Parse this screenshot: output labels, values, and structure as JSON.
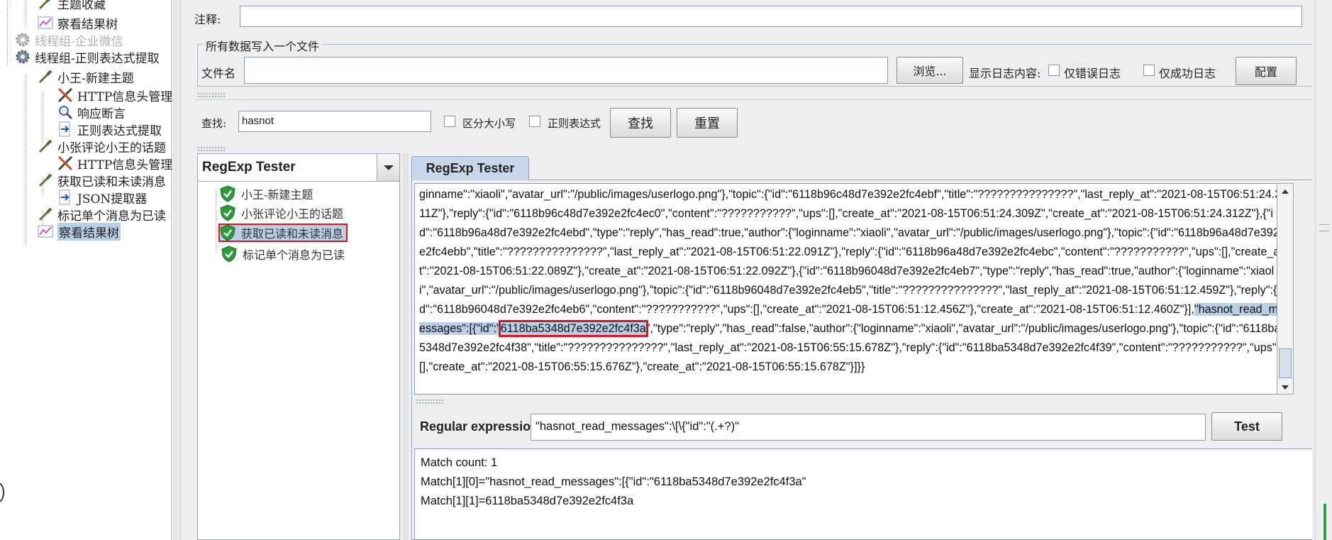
{
  "tree": {
    "items": [
      {
        "label": "主题收藏",
        "icon": "dropper-icon"
      },
      {
        "label": "察看结果树",
        "icon": "chart-icon"
      },
      {
        "label": "线程组-企业微信",
        "icon": "gear-icon"
      },
      {
        "label": "线程组-正则表达式提取",
        "icon": "gear-icon"
      },
      {
        "label": "小王-新建主题",
        "icon": "dropper-icon"
      },
      {
        "label": "HTTP信息头管理",
        "icon": "tools-icon"
      },
      {
        "label": "响应断言",
        "icon": "magnifier-icon"
      },
      {
        "label": "正则表达式提取",
        "icon": "arrow-doc-icon"
      },
      {
        "label": "小张评论小王的话题",
        "icon": "dropper-icon"
      },
      {
        "label": "HTTP信息头管理",
        "icon": "tools-icon"
      },
      {
        "label": "获取已读和未读消息",
        "icon": "dropper-icon"
      },
      {
        "label": "JSON提取器",
        "icon": "arrow-doc-icon"
      },
      {
        "label": "标记单个消息为已读",
        "icon": "dropper-icon"
      },
      {
        "label": "察看结果树",
        "icon": "chart-icon"
      }
    ]
  },
  "comment": {
    "label": "注释:",
    "value": ""
  },
  "file_section": {
    "legend": "所有数据写入一个文件",
    "filename_label": "文件名",
    "filename_value": "",
    "browse_label": "浏览...",
    "log_label": "显示日志内容:",
    "errors_only_label": "仅错误日志",
    "success_only_label": "仅成功日志",
    "config_label": "配置"
  },
  "search": {
    "label": "查找:",
    "value": "hasnot",
    "case_label": "区分大小写",
    "regex_label": "正则表达式",
    "find_label": "查找",
    "reset_label": "重置"
  },
  "renderer": {
    "selected": "RegExp Tester"
  },
  "results": [
    {
      "label": "小王-新建主题",
      "status": "success"
    },
    {
      "label": "小张评论小王的话题",
      "status": "success"
    },
    {
      "label": "获取已读和未读消息",
      "status": "success"
    },
    {
      "label": "标记单个消息为已读",
      "status": "success"
    }
  ],
  "tab_label": "RegExp Tester",
  "response": {
    "part1": "ginname\":\"xiaoli\",\"avatar_url\":\"/public/images/userlogo.png\"},\"topic\":{\"id\":\"6118b96c48d7e392e2fc4ebf\",\"title\":\"???????????????\",\"last_reply_at\":\"2021-08-15T06:51:24.311Z\"},\"reply\":{\"id\":\"6118b96c48d7e392e2fc4ec0\",\"content\":\"???????????\",\"ups\":[],\"create_at\":\"2021-08-15T06:51:24.309Z\",\"create_at\":\"2021-08-15T06:51:24.312Z\"},{\"id\":\"6118b96a48d7e392e2fc4ebd\",\"type\":\"reply\",\"has_read\":true,\"author\":{\"loginname\":\"xiaoli\",\"avatar_url\":\"/public/images/userlogo.png\"},\"topic\":{\"id\":\"6118b96a48d7e392e2fc4ebb\",\"title\":\"???????????????\",\"last_reply_at\":\"2021-08-15T06:51:22.091Z\"},\"reply\":{\"id\":\"6118b96a48d7e392e2fc4ebc\",\"content\":\"???????????\",\"ups\":[],\"create_at\":\"2021-08-15T06:51:22.089Z\"},\"create_at\":\"2021-08-15T06:51:22.092Z\"},{\"id\":\"6118b96048d7e392e2fc4eb7\",\"type\":\"reply\",\"has_read\":true,\"author\":{\"loginname\":\"xiaoli\",\"avatar_url\":\"/public/images/userlogo.png\"},\"topic\":{\"id\":\"6118b96048d7e392e2fc4eb5\",\"title\":\"???????????????\",\"last_reply_at\":\"2021-08-15T06:51:12.459Z\"},\"reply\":{\"id\":\"6118b96048d7e392e2fc4eb6\",\"content\":\"???????????\",\"ups\":[],\"create_at\":\"2021-08-15T06:51:12.456Z\"},\"create_at\":\"2021-08-15T06:51:12.460Z\"}],",
    "highlight": "\"hasnot_read_messages\":[{\"id\":\"",
    "match_id": "6118ba5348d7e392e2fc4f3a",
    "part2": "\",\"type\":\"reply\",\"has_read\":false,\"author\":{\"loginname\":\"xiaoli\",\"avatar_url\":\"/public/images/userlogo.png\"},\"topic\":{\"id\":\"6118ba5348d7e392e2fc4f38\",\"title\":\"???????????????\",\"last_reply_at\":\"2021-08-15T06:55:15.678Z\"},\"reply\":{\"id\":\"6118ba5348d7e392e2fc4f39\",\"content\":\"???????????\",\"ups\":[],\"create_at\":\"2021-08-15T06:55:15.676Z\"},\"create_at\":\"2021-08-15T06:55:15.678Z\"}]}}"
  },
  "regex": {
    "label": "Regular expression:",
    "value": "\"hasnot_read_messages\":\\[\\{\"id\":\"(.+?)\"",
    "test_label": "Test"
  },
  "matches": [
    "Match count: 1",
    "Match[1][0]=\"hasnot_read_messages\":[{\"id\":\"6118ba5348d7e392e2fc4f3a\"",
    "Match[1][1]=6118ba5348d7e392e2fc4f3a"
  ]
}
